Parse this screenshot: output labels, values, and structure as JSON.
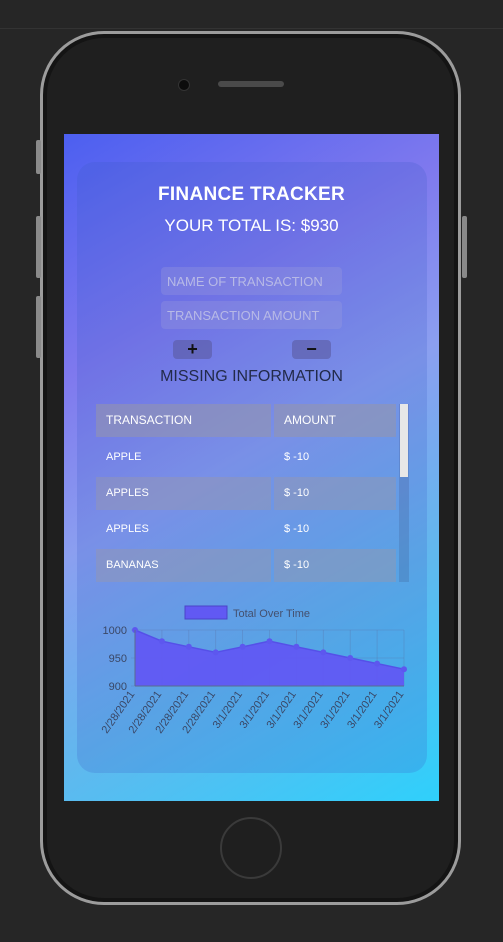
{
  "app": {
    "title": "FINANCE TRACKER",
    "total_text": "YOUR TOTAL IS: $930",
    "name_placeholder": "NAME OF TRANSACTION",
    "amount_placeholder": "TRANSACTION AMOUNT",
    "plus_label": "+",
    "minus_label": "−",
    "message": "MISSING INFORMATION"
  },
  "table": {
    "headers": [
      "TRANSACTION",
      "AMOUNT"
    ],
    "rows": [
      {
        "name": "APPLE",
        "amount": "$ -10"
      },
      {
        "name": "APPLES",
        "amount": "$ -10"
      },
      {
        "name": "APPLES",
        "amount": "$ -10"
      },
      {
        "name": "BANANAS",
        "amount": "$ -10"
      }
    ]
  },
  "chart_data": {
    "type": "area",
    "legend": "Total Over Time",
    "legend_color": "#6159f3",
    "x": [
      "2/28/2021",
      "2/28/2021",
      "2/28/2021",
      "2/28/2021",
      "3/1/2021",
      "3/1/2021",
      "3/1/2021",
      "3/1/2021",
      "3/1/2021",
      "3/1/2021",
      "3/1/2021"
    ],
    "values": [
      1000,
      980,
      970,
      960,
      970,
      980,
      970,
      960,
      950,
      940,
      930
    ],
    "ylim": [
      900,
      1000
    ],
    "yticks": [
      1000,
      950,
      900
    ],
    "grid": true
  }
}
